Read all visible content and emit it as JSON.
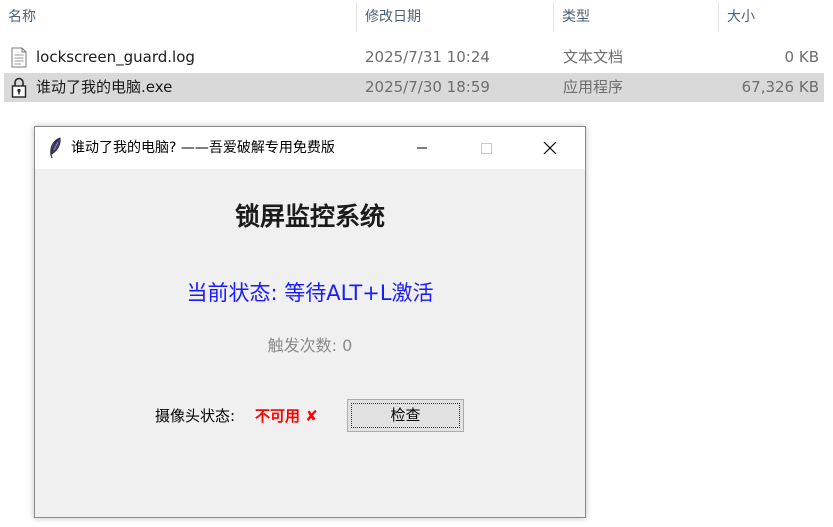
{
  "explorer": {
    "columns": {
      "name": "名称",
      "date": "修改日期",
      "type": "类型",
      "size": "大小"
    },
    "files": [
      {
        "name": "lockscreen_guard.log",
        "date": "2025/7/31 10:24",
        "type": "文本文档",
        "size": "0 KB",
        "icon": "text-file-icon",
        "selected": false
      },
      {
        "name": "谁动了我的电脑.exe",
        "date": "2025/7/30 18:59",
        "type": "应用程序",
        "size": "67,326 KB",
        "icon": "lock-exe-icon",
        "selected": true
      }
    ]
  },
  "window": {
    "title": "谁动了我的电脑? ——吾爱破解专用免费版",
    "icon": "feather-icon",
    "heading": "锁屏监控系统",
    "status": "当前状态: 等待ALT+L激活",
    "trigger_count": "触发次数: 0",
    "camera_label": "摄像头状态:",
    "camera_value": "不可用 ✘",
    "check_button": "检查",
    "colors": {
      "status": "#1a1aff",
      "camera_value": "#ff0000",
      "count": "#8a8a8a"
    }
  }
}
